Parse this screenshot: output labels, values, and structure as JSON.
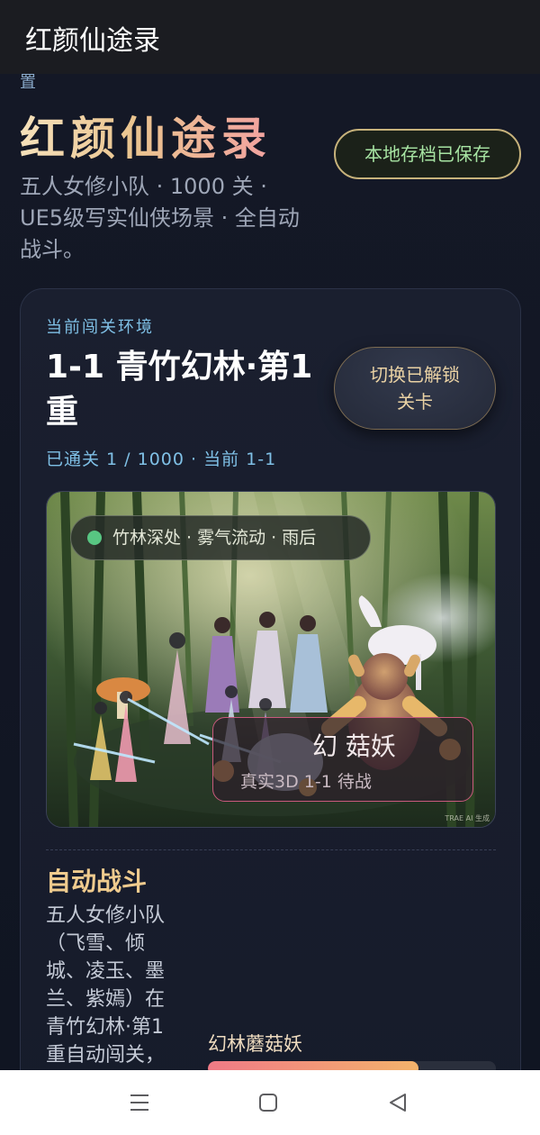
{
  "appbar": {
    "title": "红颜仙途录"
  },
  "hero": {
    "cut_label": "置",
    "title": "红颜仙途录",
    "save_status": "本地存档已保存",
    "description": "五人女修小队 · 1000 关 · UE5级写实仙侠场景 · 全自动战斗。"
  },
  "level_card": {
    "env_label": "当前闯关环境",
    "level_title": "1-1 青竹幻林·第1重",
    "switch_button": "切换已解锁关卡",
    "progress": "已通关 1 / 1000 · 当前 1-1",
    "scene_tag": "竹林深处 · 雾气流动 · 雨后",
    "scene_enemy_name": "幻      菇妖",
    "scene_enemy_sub": "真实3D  1-1        待战",
    "watermark": "TRAE AI 生成",
    "status_dot_color": "#58c682"
  },
  "battle": {
    "title": "自动战斗",
    "description": "五人女修小队（飞雪、倾城、凌玉、墨兰、紫嫣）在青竹幻林·第1重自动闯关，",
    "enemy_name": "幻林蘑菇妖",
    "enemy_hp_fraction": 0.73
  },
  "navbar": {
    "icons": [
      "menu-icon",
      "home-square-icon",
      "back-triangle-icon"
    ]
  },
  "colors": {
    "accent_gold": "#efcb8e",
    "accent_blue": "#7fc0e6",
    "save_green": "#a7e4a3"
  }
}
